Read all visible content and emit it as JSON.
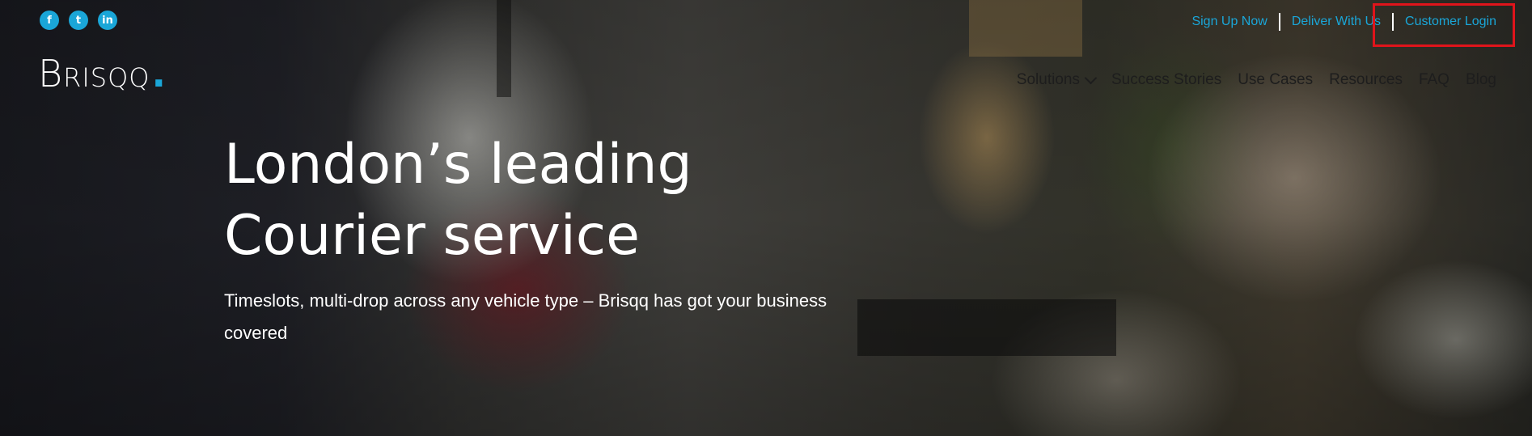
{
  "social": {
    "facebook": "f",
    "twitter": "t",
    "linkedin": "in"
  },
  "logo": {
    "initial": "B",
    "rest": "RISQQ",
    "dot": "."
  },
  "toplinks": {
    "sign_up": "Sign Up Now",
    "deliver": "Deliver With Us",
    "login": "Customer Login"
  },
  "nav": {
    "items": [
      "Solutions",
      "Success Stories",
      "Use Cases",
      "Resources",
      "FAQ",
      "Blog"
    ]
  },
  "hero": {
    "headline_line1": "London’s leading",
    "headline_line2": "Courier service",
    "subtext": "Timeslots, multi-drop across any vehicle type – Brisqq has got your business covered"
  },
  "colors": {
    "accent": "#1aa6d8",
    "highlight": "#e0141b"
  }
}
